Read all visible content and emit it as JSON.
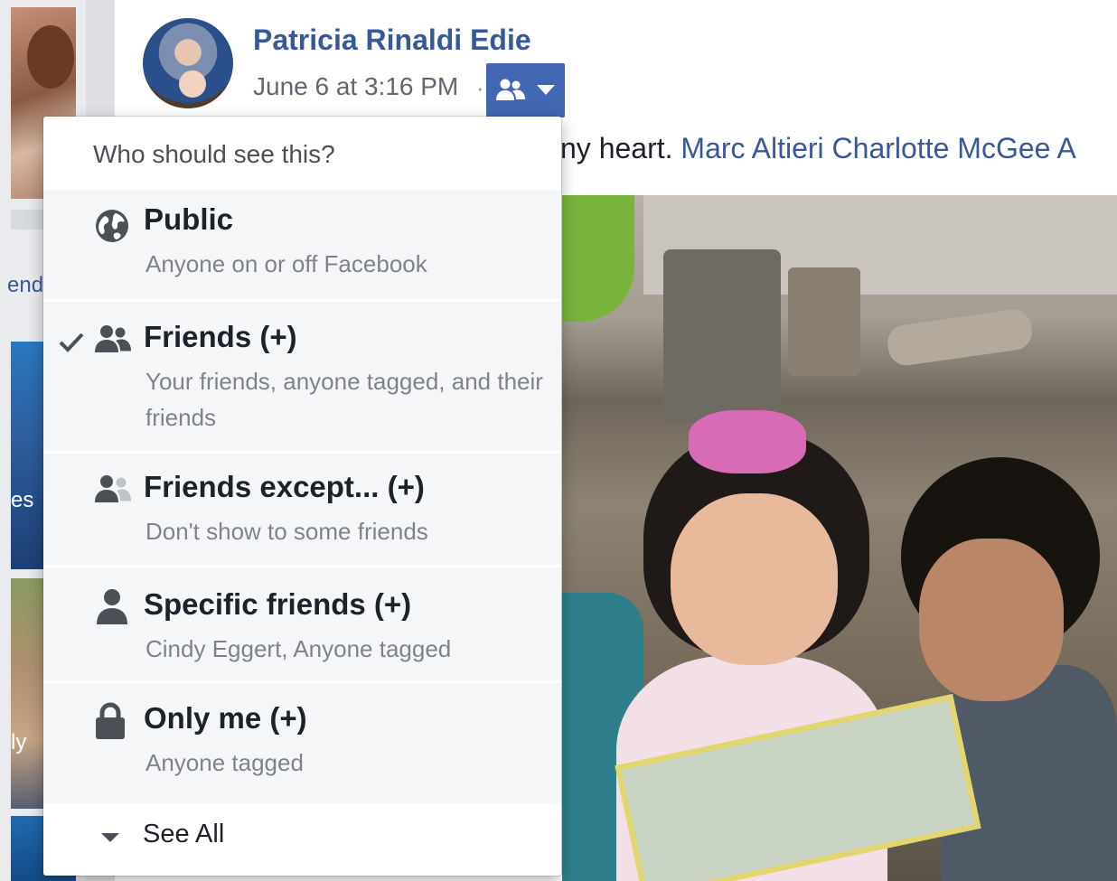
{
  "post": {
    "author": "Patricia Rinaldi Edie",
    "timestamp": "June 6 at 3:16 PM",
    "separator": "·",
    "text_visible": "ny heart.",
    "tags": [
      "Marc Altieri",
      "Charlotte McGee"
    ],
    "tag_overflow": "A",
    "privacy_icon": "friends-icon"
  },
  "left_column": {
    "link_fragment": "end",
    "thumb_label_1": "es",
    "thumb_label_2": "ly"
  },
  "audience_menu": {
    "header": "Who should see this?",
    "options": [
      {
        "title": "Public",
        "description": "Anyone on or off Facebook",
        "icon": "globe-icon",
        "selected": false
      },
      {
        "title": "Friends (+)",
        "description": "Your friends, anyone tagged, and their friends",
        "icon": "friends-icon",
        "selected": true
      },
      {
        "title": "Friends except... (+)",
        "description": "Don't show to some friends",
        "icon": "friends-except-icon",
        "selected": false
      },
      {
        "title": "Specific friends (+)",
        "description": "Cindy Eggert, Anyone tagged",
        "icon": "person-icon",
        "selected": false
      },
      {
        "title": "Only me (+)",
        "description": "Anyone tagged",
        "icon": "lock-icon",
        "selected": false
      }
    ],
    "see_all": "See All"
  },
  "colors": {
    "link_blue": "#385898",
    "button_blue": "#4267b2",
    "option_bg": "#f5f6f7",
    "muted_text": "#7f8389"
  }
}
